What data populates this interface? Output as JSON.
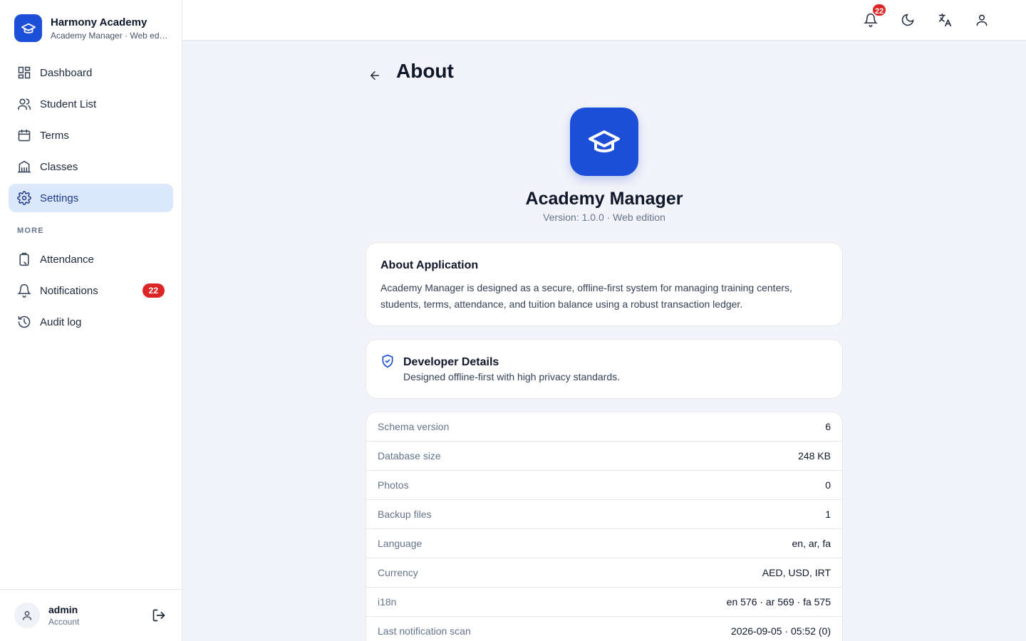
{
  "brand": {
    "title": "Harmony Academy",
    "subtitle": "Academy Manager · Web edition"
  },
  "sidebar": {
    "items": [
      {
        "label": "Dashboard",
        "icon": "dashboard-icon"
      },
      {
        "label": "Student List",
        "icon": "users-icon"
      },
      {
        "label": "Terms",
        "icon": "calendar-icon"
      },
      {
        "label": "Classes",
        "icon": "building-icon"
      },
      {
        "label": "Settings",
        "icon": "gear-icon",
        "active": true
      }
    ],
    "more_label": "MORE",
    "more_items": [
      {
        "label": "Attendance",
        "icon": "clipboard-icon"
      },
      {
        "label": "Notifications",
        "icon": "bell-icon",
        "badge": "22"
      },
      {
        "label": "Audit log",
        "icon": "history-icon"
      }
    ]
  },
  "user": {
    "name": "admin",
    "role": "Account"
  },
  "topbar": {
    "notifications_badge": "22"
  },
  "page": {
    "title": "About",
    "app_name": "Academy Manager",
    "version": "Version: 1.0.0 · Web edition"
  },
  "about_card": {
    "title": "About Application",
    "text": "Academy Manager is designed as a secure, offline-first system for managing training centers, students, terms, attendance, and tuition balance using a robust transaction ledger."
  },
  "developer_card": {
    "title": "Developer Details",
    "subtitle": "Designed offline-first with high privacy standards."
  },
  "info_rows": [
    {
      "label": "Schema version",
      "value": "6"
    },
    {
      "label": "Database size",
      "value": "248 KB"
    },
    {
      "label": "Photos",
      "value": "0"
    },
    {
      "label": "Backup files",
      "value": "1"
    },
    {
      "label": "Language",
      "value": "en, ar, fa"
    },
    {
      "label": "Currency",
      "value": "AED, USD, IRT"
    },
    {
      "label": "i18n",
      "value": "en 576 · ar 569 · fa 575"
    },
    {
      "label": "Last notification scan",
      "value": "2026-09-05 · 05:52 (0)"
    }
  ],
  "colors": {
    "accent": "#1d4ed8",
    "active_bg": "#dbe7fb",
    "badge": "#dc2626"
  }
}
